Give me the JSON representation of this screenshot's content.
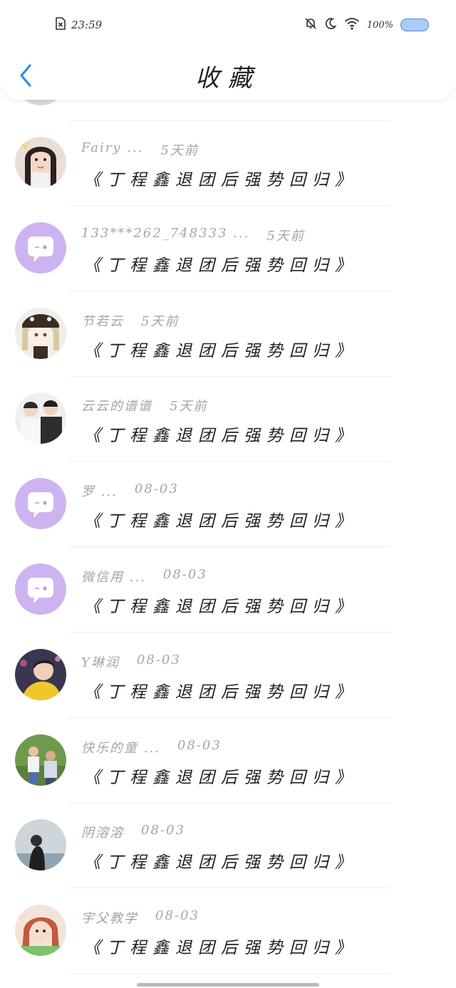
{
  "status_bar": {
    "time": "23:59",
    "battery": "100%"
  },
  "header": {
    "title": "收藏"
  },
  "list": [
    {
      "name": "Fairy ...",
      "time": "5天前",
      "title": "《丁程鑫退团后强势回归》",
      "avatar": "photo-girl"
    },
    {
      "name": "133***262_748333 ...",
      "time": "5天前",
      "title": "《丁程鑫退团后强势回归》",
      "avatar": "default-chat"
    },
    {
      "name": "节若云",
      "time": "5天前",
      "title": "《丁程鑫退团后强势回归》",
      "avatar": "anime-girl"
    },
    {
      "name": "云云的谱谱",
      "time": "5天前",
      "title": "《丁程鑫退团后强势回归》",
      "avatar": "photo-two-boys"
    },
    {
      "name": "罗 ...",
      "time": "08-03",
      "title": "《丁程鑫退团后强势回归》",
      "avatar": "default-chat"
    },
    {
      "name": "微信用 ...",
      "time": "08-03",
      "title": "《丁程鑫退团后强势回归》",
      "avatar": "default-chat"
    },
    {
      "name": "Y琳润",
      "time": "08-03",
      "title": "《丁程鑫退团后强势回归》",
      "avatar": "photo-boy-yellow"
    },
    {
      "name": "快乐的童 ...",
      "time": "08-03",
      "title": "《丁程鑫退团后强势回归》",
      "avatar": "photo-family"
    },
    {
      "name": "阴溶溶",
      "time": "08-03",
      "title": "《丁程鑫退团后强势回归》",
      "avatar": "photo-lake"
    },
    {
      "name": "宇父教学",
      "time": "08-03",
      "title": "《丁程鑫退团后强势回归》",
      "avatar": "photo-redhair"
    }
  ],
  "colors": {
    "accent": "#2d8de6",
    "default_avatar": "#cdb4f0",
    "meta_text": "#a5a5a5",
    "title_text": "#222222"
  }
}
